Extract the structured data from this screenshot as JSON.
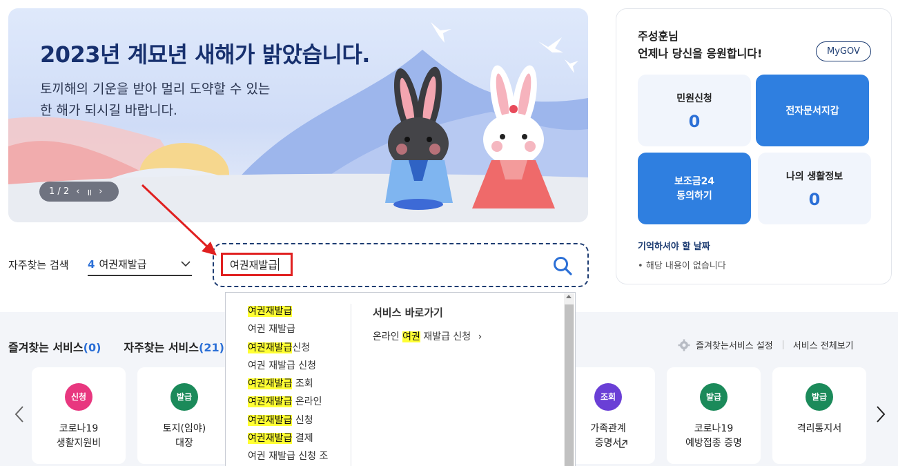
{
  "banner": {
    "title": "2023년 계묘년 새해가 밝았습니다.",
    "sub_line1": "토끼해의 기운을 받아 멀리 도약할 수 있는",
    "sub_line2": "한 해가 되시길 바랍니다.",
    "pager_text": "1 / 2",
    "prev": "‹",
    "pause": "॥",
    "next": "›"
  },
  "search": {
    "freq_label": "자주찾는 검색",
    "freq_rank": "4",
    "freq_value": "여권재발급",
    "input_value": "여권재발급"
  },
  "autocomplete": {
    "items": [
      {
        "hl": "여권재발급",
        "rest": ""
      },
      {
        "hl": "",
        "rest": "여권 재발급"
      },
      {
        "hl": "여권재발급",
        "rest": "신청"
      },
      {
        "hl": "",
        "rest": "여권 재발급 신청"
      },
      {
        "hl": "여권재발급",
        "rest": " 조회"
      },
      {
        "hl": "여권재발급",
        "rest": " 온라인"
      },
      {
        "hl": "여권재발급",
        "rest": " 신청"
      },
      {
        "hl": "여권재발급",
        "rest": " 결제"
      },
      {
        "hl": "",
        "rest": "여권 재발급 신청 조"
      }
    ],
    "shortcut_title": "서비스 바로가기",
    "shortcut_pre": "온라인 ",
    "shortcut_hl": "여권",
    "shortcut_post": " 재발급 신청",
    "shortcut_arrow": "›"
  },
  "services": {
    "tab_fav": "즐겨찾는 서비스",
    "tab_fav_count": "(0)",
    "tab_freq": "자주찾는 서비스",
    "tab_freq_count": "(21)",
    "settings_label": "즐겨찾는서비스 설정",
    "view_all_label": "서비스 전체보기",
    "cards": [
      {
        "badge": "신청",
        "color": "#e8377f",
        "text": "코로나19\n생활지원비"
      },
      {
        "badge": "발급",
        "color": "#1b8a5a",
        "text": "토지(임야)\n대장"
      },
      {
        "badge": "조회",
        "color": "#6a3fd6",
        "text": "가족관계\n증명서"
      },
      {
        "badge": "발급",
        "color": "#1b8a5a",
        "text": "코로나19\n예방접종 증명"
      },
      {
        "badge": "발급",
        "color": "#1b8a5a",
        "text": "격리통지서"
      }
    ]
  },
  "panel": {
    "greet_name": "주성훈님",
    "greet_msg": "언제나 당신을 응원합니다!",
    "mygov": "MyGOV",
    "civil_label": "민원신청",
    "civil_count": "0",
    "wallet_label": "전자문서지갑",
    "subsidy_line1": "보조금24",
    "subsidy_line2": "동의하기",
    "life_label": "나의 생활정보",
    "life_count": "0",
    "remember_title": "기억하셔야 할 날짜",
    "remember_empty": "해당 내용이 없습니다"
  },
  "colors": {
    "accent": "#2b6fd6",
    "tile_blue": "#2f7fe0",
    "navy": "#1d3c72",
    "highlight": "#ffff33",
    "annotation_red": "#e02020"
  }
}
